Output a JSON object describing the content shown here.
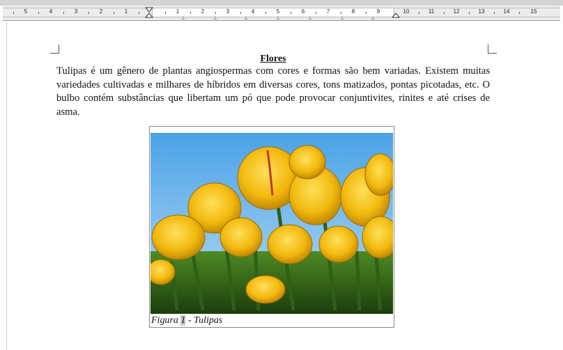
{
  "ruler": {
    "left_numbers": [
      "5",
      "4",
      "3",
      "2",
      "1"
    ],
    "right_numbers": [
      "1",
      "2",
      "3",
      "4",
      "5",
      "6",
      "7",
      "8",
      "9",
      "10",
      "11",
      "12",
      "13",
      "14",
      "15"
    ]
  },
  "document": {
    "title": "Flores",
    "paragraph": "Tulipas é um gênero de plantas angiospermas com cores e formas são bem variadas. Existem muitas variedades cultivadas e milhares de híbridos em diversas cores, tons matizados, pontas picotadas, etc. O bulbo contém substâncias que libertam um pó que pode provocar conjuntivites, rinites e até crises de asma."
  },
  "figure": {
    "image_icon": "tulips-photo",
    "caption_prefix": "Figura ",
    "caption_number": "1",
    "caption_suffix": " - Tulipas"
  }
}
